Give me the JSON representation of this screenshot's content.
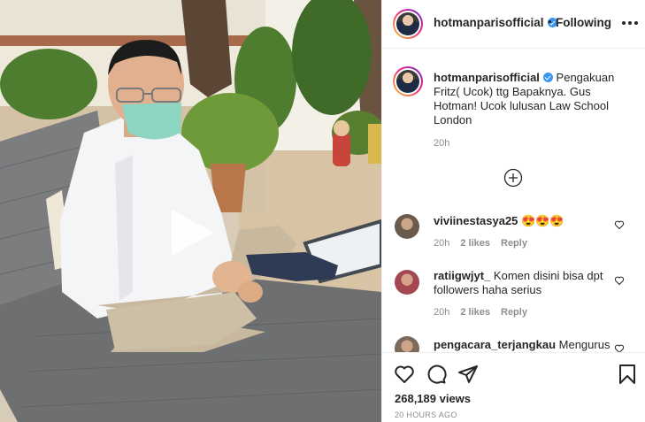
{
  "post": {
    "username": "hotmanparisofficial",
    "follow_status": "Following",
    "dot": "•",
    "caption": "Pengakuan Fritz( Ucok) ttg Bapaknya. Gus Hotman! Ucok lulusan Law School London",
    "caption_time": "20h",
    "views": "268,189 views",
    "posted_ago": "20 HOURS AGO"
  },
  "comments": [
    {
      "username": "viviinestasya25",
      "text": "😍😍😍",
      "time": "20h",
      "likes": "2 likes",
      "reply": "Reply"
    },
    {
      "username": "ratiigwjyt_",
      "text": "Komen disini bisa dpt followers haha serius",
      "time": "20h",
      "likes": "2 likes",
      "reply": "Reply"
    },
    {
      "username": "pengacara_terjangkau",
      "text": "Mengurus"
    }
  ],
  "icons": {
    "verified": "verified-badge-icon",
    "more": "more-options-icon",
    "load_more": "plus-circle-icon",
    "play": "play-icon",
    "like": "heart-icon",
    "comment": "comment-icon",
    "share": "share-icon",
    "save": "bookmark-icon"
  },
  "colors": {
    "verified": "#3897f0",
    "muted_text": "#8e8e8e",
    "divider": "#efefef"
  }
}
